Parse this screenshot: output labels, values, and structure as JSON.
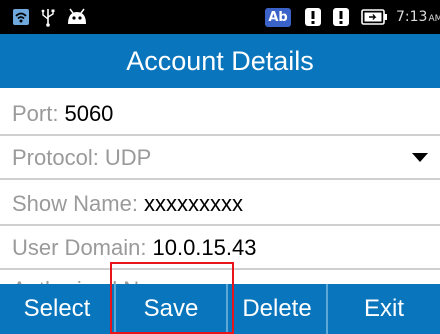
{
  "status_bar": {
    "icons": [
      "wifi-icon",
      "usb-icon",
      "android-icon",
      "keyboard-ab-icon",
      "warning-icon",
      "warning-icon",
      "battery-charging-icon"
    ],
    "ab_badge": "Ab",
    "time": "7:13",
    "ampm": "AM"
  },
  "header": {
    "title": "Account Details"
  },
  "fields": {
    "port": {
      "label": "Port:",
      "value": "5060"
    },
    "protocol": {
      "label": "Protocol:",
      "value": "UDP"
    },
    "show_name": {
      "label": "Show Name:",
      "value": "xxxxxxxxx"
    },
    "user_domain": {
      "label": "User Domain:",
      "value": "10.0.15.43"
    },
    "partial": {
      "label": "Authorized N"
    }
  },
  "buttons": {
    "select": "Select",
    "save": "Save",
    "delete": "Delete",
    "exit": "Exit"
  },
  "colors": {
    "accent": "#0875bd",
    "highlight": "#e8141b",
    "status_bar": "#000000"
  }
}
